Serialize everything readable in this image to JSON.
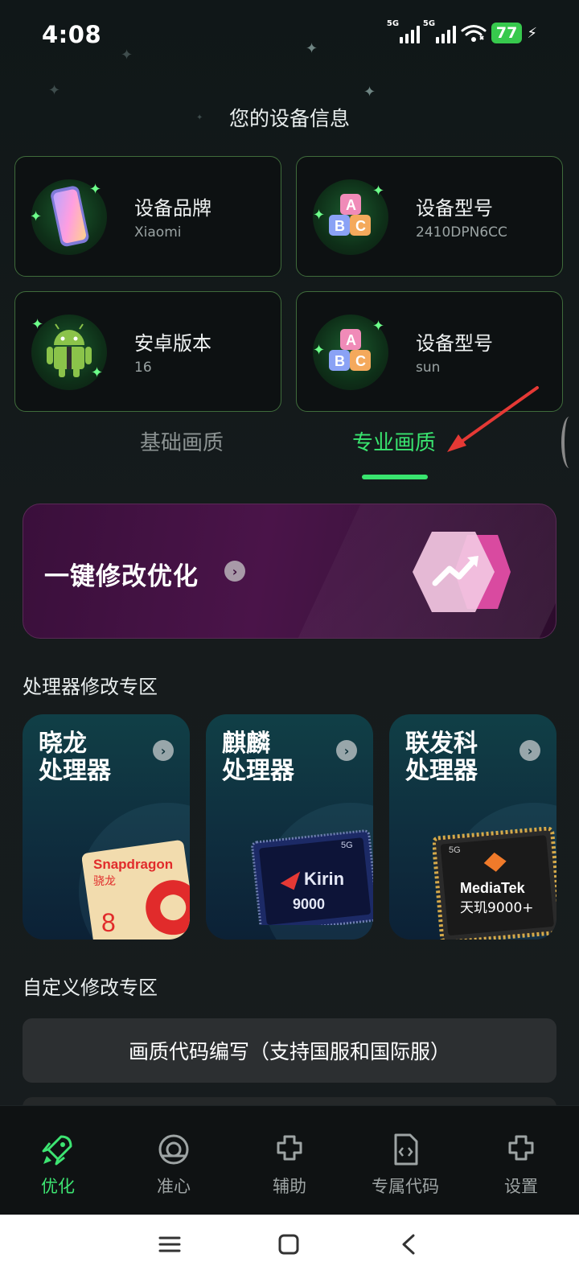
{
  "status_bar": {
    "time": "4:08",
    "signal1_label": "5G",
    "signal2_label": "5G",
    "battery": "77",
    "icons": [
      "signal-5g-icon",
      "signal-5g-icon",
      "wifi-icon",
      "battery-icon",
      "charging-bolt-icon"
    ]
  },
  "device_section": {
    "title": "您的设备信息",
    "cards": [
      {
        "label": "设备品牌",
        "value": "Xiaomi",
        "icon": "phone-icon"
      },
      {
        "label": "设备型号",
        "value": "2410DPN6CC",
        "icon": "abc-blocks-icon"
      },
      {
        "label": "安卓版本",
        "value": "16",
        "icon": "android-robot-icon"
      },
      {
        "label": "设备型号",
        "value": "sun",
        "icon": "abc-blocks-icon"
      }
    ]
  },
  "tabs": {
    "basic": "基础画质",
    "pro": "专业画质",
    "active": "pro"
  },
  "banner": {
    "title": "一键修改优化",
    "icon": "trend-up-hexagon-icon"
  },
  "processor_section": {
    "title": "处理器修改专区",
    "cards": [
      {
        "line1": "晓龙",
        "line2": "处理器",
        "chip": "snapdragon-chip-icon",
        "chip_brand": "Snapdragon",
        "chip_cn": "骁龙",
        "chip_num": "8"
      },
      {
        "line1": "麒麟",
        "line2": "处理器",
        "chip": "kirin-chip-icon",
        "chip_brand": "Kirin",
        "chip_num": "9000",
        "chip_tag": "5G"
      },
      {
        "line1": "联发科",
        "line2": "处理器",
        "chip": "mediatek-chip-icon",
        "chip_brand": "MediaTek",
        "chip_cn": "天玑9000+",
        "chip_tag": "5G"
      }
    ]
  },
  "custom_section": {
    "title": "自定义修改专区",
    "button": "画质代码编写（支持国服和国际服）"
  },
  "bottom_nav": {
    "items": [
      {
        "label": "优化",
        "icon": "rocket-icon",
        "active": true
      },
      {
        "label": "准心",
        "icon": "crosshair-icon",
        "active": false
      },
      {
        "label": "辅助",
        "icon": "puzzle-icon",
        "active": false
      },
      {
        "label": "专属代码",
        "icon": "code-file-icon",
        "active": false
      },
      {
        "label": "设置",
        "icon": "puzzle-settings-icon",
        "active": false
      }
    ]
  },
  "system_nav": {
    "icons": [
      "menu-icon",
      "home-square-icon",
      "back-icon"
    ]
  },
  "colors": {
    "accent_green": "#39e46f",
    "card_border": "#3f6b3b",
    "banner_purple": "#4a1449",
    "annotation_red": "#e53935"
  }
}
